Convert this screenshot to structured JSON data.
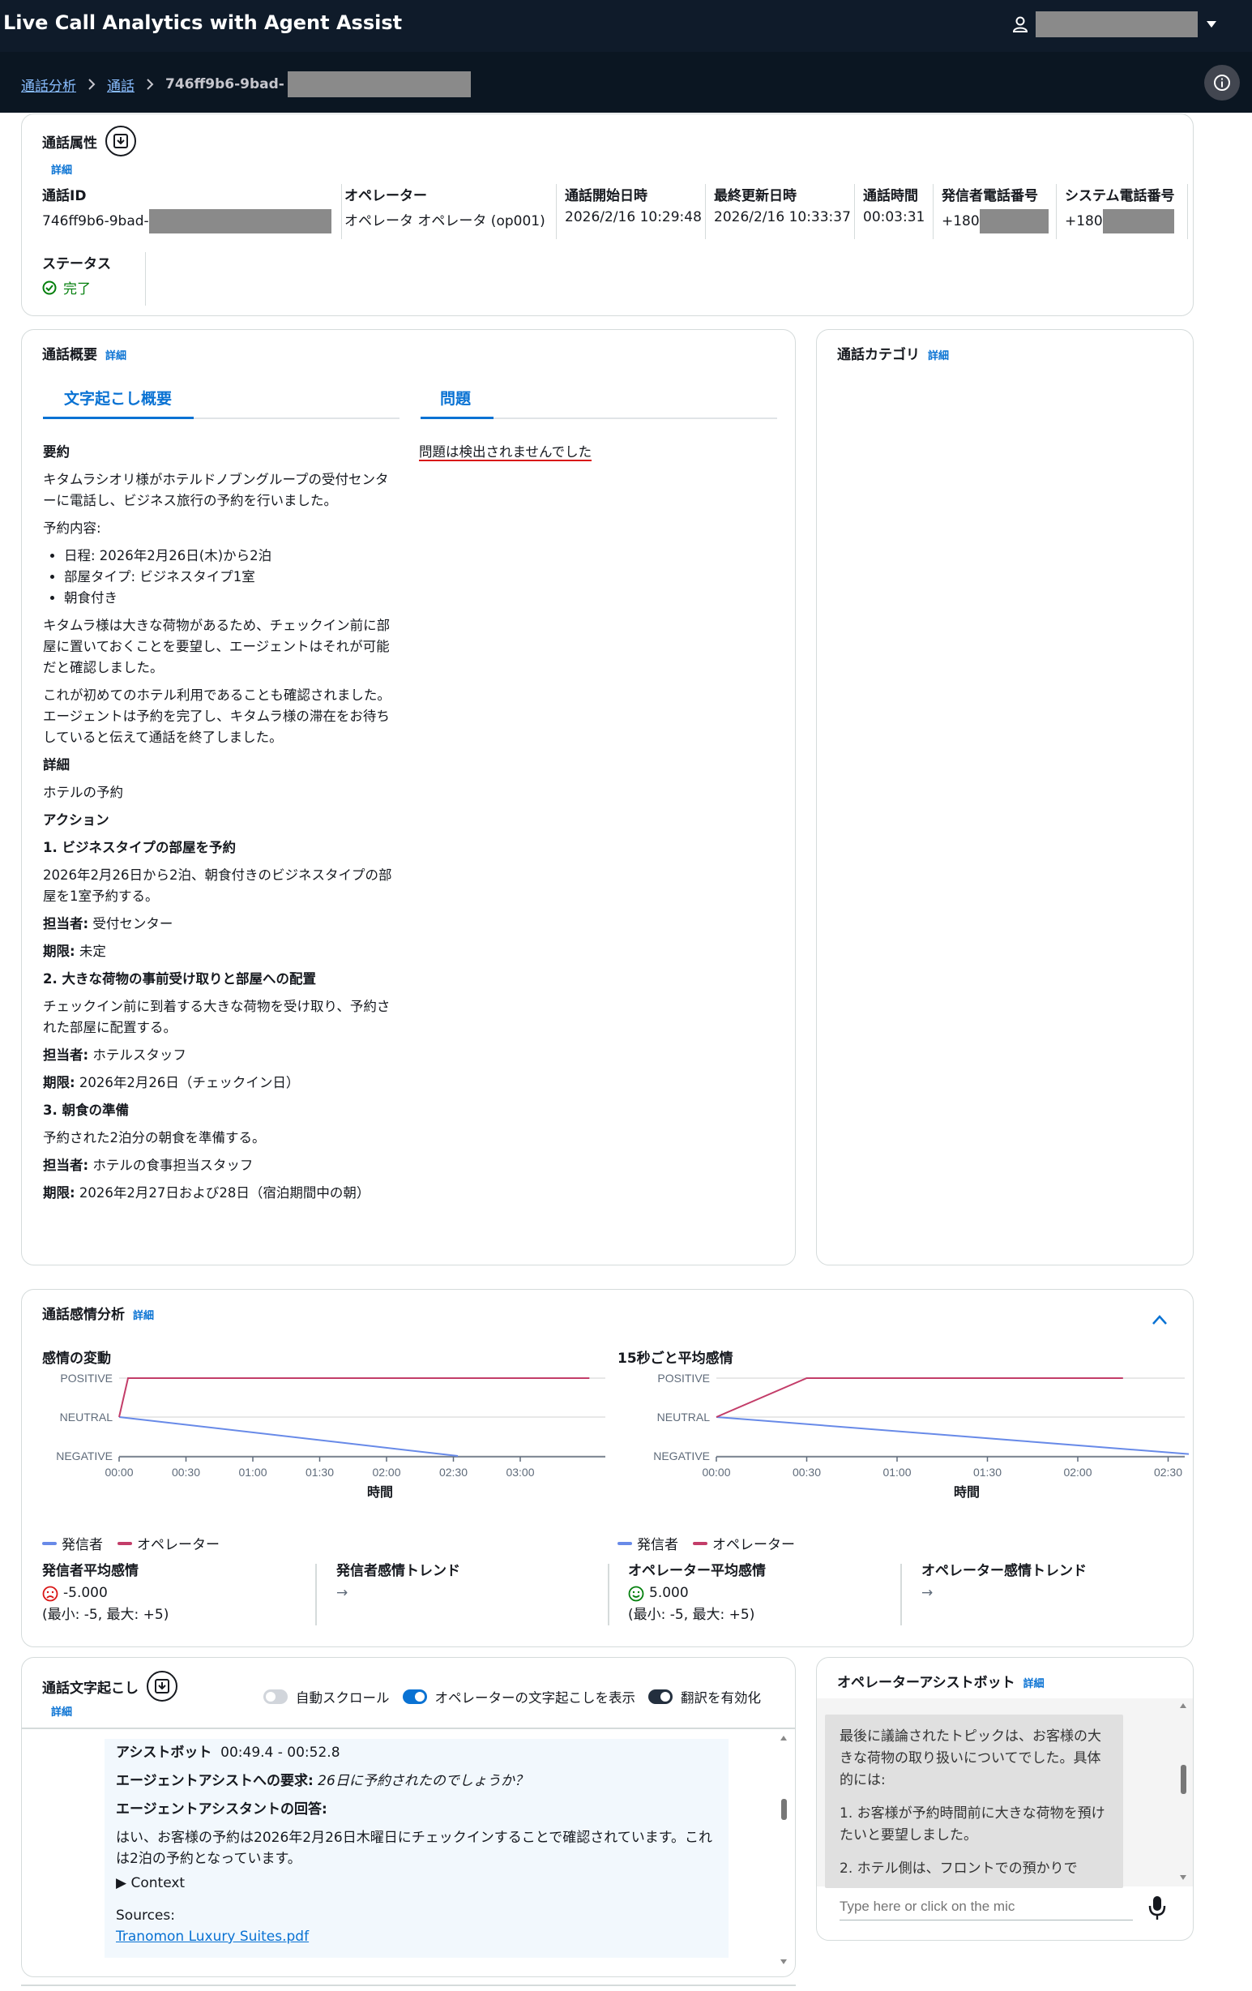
{
  "app": {
    "title": "Live Call Analytics with Agent Assist"
  },
  "breadcrumb": {
    "items": [
      "通話分析",
      "通話"
    ],
    "current": "746ff9b6-9bad-"
  },
  "attributes": {
    "title": "通話属性",
    "detail": "詳細",
    "fields": [
      {
        "label": "通話ID",
        "value": "746ff9b6-9bad-"
      },
      {
        "label": "オペレーター",
        "value": "オペレータ オペレータ (op001)"
      },
      {
        "label": "通話開始日時",
        "value": "2026/2/16 10:29:48"
      },
      {
        "label": "最終更新日時",
        "value": "2026/2/16 10:33:37"
      },
      {
        "label": "通話時間",
        "value": "00:03:31"
      },
      {
        "label": "発信者電話番号",
        "value": "+180"
      },
      {
        "label": "システム電話番号",
        "value": "+180"
      }
    ],
    "status": {
      "label": "ステータス",
      "value": "完了"
    }
  },
  "summary_panel": {
    "title": "通話概要",
    "detail": "詳細",
    "tabs": [
      "文字起こし概要",
      "問題"
    ],
    "issues_text": "問題は検出されませんでした",
    "summary": {
      "h_summary": "要約",
      "p1": "キタムラシオリ様がホテルドノブングループの受付センターに電話し、ビジネス旅行の予約を行いました。",
      "p2": "予約内容:",
      "bullets": [
        "日程: 2026年2月26日(木)から2泊",
        "部屋タイプ: ビジネスタイプ1室",
        "朝食付き"
      ],
      "p3": "キタムラ様は大きな荷物があるため、チェックイン前に部屋に置いておくことを要望し、エージェントはそれが可能だと確認しました。",
      "p4": "これが初めてのホテル利用であることも確認されました。エージェントは予約を完了し、キタムラ様の滞在をお待ちしていると伝えて通話を終了しました。",
      "h_detail": "詳細",
      "detail_text": "ホテルの予約",
      "h_action": "アクション",
      "a1_title": "1. ビジネスタイプの部屋を予約",
      "a1_text": "2026年2月26日から2泊、朝食付きのビジネスタイプの部屋を1室予約する。",
      "a1_owner_k": "担当者:",
      "a1_owner": " 受付センター",
      "a1_due_k": "期限:",
      "a1_due": " 未定",
      "a2_title": "2. 大きな荷物の事前受け取りと部屋への配置",
      "a2_text": "チェックイン前に到着する大きな荷物を受け取り、予約された部屋に配置する。",
      "a2_owner_k": "担当者:",
      "a2_owner": " ホテルスタッフ",
      "a2_due_k": "期限:",
      "a2_due": " 2026年2月26日（チェックイン日）",
      "a3_title": "3. 朝食の準備",
      "a3_text": "予約された2泊分の朝食を準備する。",
      "a3_owner_k": "担当者:",
      "a3_owner": " ホテルの食事担当スタッフ",
      "a3_due_k": "期限:",
      "a3_due": " 2026年2月27日および28日（宿泊期間中の朝）"
    }
  },
  "category_panel": {
    "title": "通話カテゴリ",
    "detail": "詳細"
  },
  "sentiment_panel": {
    "title": "通話感情分析",
    "detail": "詳細",
    "legend": {
      "caller": "発信者",
      "agent": "オペレーター"
    },
    "stats": {
      "caller_avg_label": "発信者平均感情",
      "caller_avg": "-5.000",
      "caller_range": "(最小: -5, 最大: +5)",
      "caller_trend_label": "発信者感情トレンド",
      "caller_trend": "→",
      "agent_avg_label": "オペレーター平均感情",
      "agent_avg": "5.000",
      "agent_range": "(最小: -5, 最大: +5)",
      "agent_trend_label": "オペレーター感情トレンド",
      "agent_trend": "→"
    },
    "colors": {
      "caller": "#688ae8",
      "agent": "#c33d69"
    }
  },
  "chart_data": [
    {
      "type": "line",
      "title": "感情の変動",
      "xlabel": "時間",
      "x_ticks": [
        "00:00",
        "00:30",
        "01:00",
        "01:30",
        "02:00",
        "02:30",
        "03:00"
      ],
      "y_categories": [
        "NEGATIVE",
        "NEUTRAL",
        "POSITIVE"
      ],
      "series": [
        {
          "name": "発信者",
          "points": [
            [
              "00:00",
              "NEUTRAL"
            ],
            [
              "02:32",
              "NEGATIVE"
            ]
          ]
        },
        {
          "name": "オペレーター",
          "points": [
            [
              "00:00",
              "NEUTRAL"
            ],
            [
              "00:04",
              "POSITIVE"
            ],
            [
              "03:31",
              "POSITIVE"
            ]
          ]
        }
      ]
    },
    {
      "type": "line",
      "title": "15秒ごと平均感情",
      "xlabel": "時間",
      "x_ticks": [
        "00:00",
        "00:30",
        "01:00",
        "01:30",
        "02:00",
        "02:30"
      ],
      "y_categories": [
        "NEGATIVE",
        "NEUTRAL",
        "POSITIVE"
      ],
      "series": [
        {
          "name": "発信者",
          "points": [
            [
              "00:00",
              "NEUTRAL"
            ],
            [
              "02:45",
              "NEGATIVE"
            ]
          ]
        },
        {
          "name": "オペレーター",
          "points": [
            [
              "00:00",
              "NEUTRAL"
            ],
            [
              "00:30",
              "POSITIVE"
            ],
            [
              "02:15",
              "POSITIVE"
            ]
          ]
        }
      ]
    }
  ],
  "transcript_panel": {
    "title": "通話文字起こし",
    "detail": "詳細",
    "toggles": [
      {
        "label": "自動スクロール",
        "state": "off"
      },
      {
        "label": "オペレーターの文字起こしを表示",
        "state": "on"
      },
      {
        "label": "翻訳を有効化",
        "state": "on"
      }
    ],
    "message": {
      "speaker": "アシストボット",
      "time": "00:49.4 - 00:52.8",
      "req_label": "エージェントアシストへの要求:",
      "req_text": " 26日に予約されたのでしょうか？",
      "resp_label": "エージェントアシスタントの回答:",
      "resp_text": "はい、お客様の予約は2026年2月26日木曜日にチェックインすることで確認されています。これは2泊の予約となっています。",
      "context": "▶ Context",
      "sources_label": "Sources:",
      "source_link": "Tranomon Luxury Suites.pdf"
    }
  },
  "assist_panel": {
    "title": "オペレーターアシストボット",
    "detail": "詳細",
    "message": "最後に議論されたトピックは、お客様の大きな荷物の取り扱いについてでした。具体的には:",
    "items": [
      "1. お客様が予約時間前に大きな荷物を預けたいと要望しました。",
      "2. ホテル側は、フロントでの預かりで"
    ],
    "input_placeholder": "Type here or click on the mic"
  }
}
